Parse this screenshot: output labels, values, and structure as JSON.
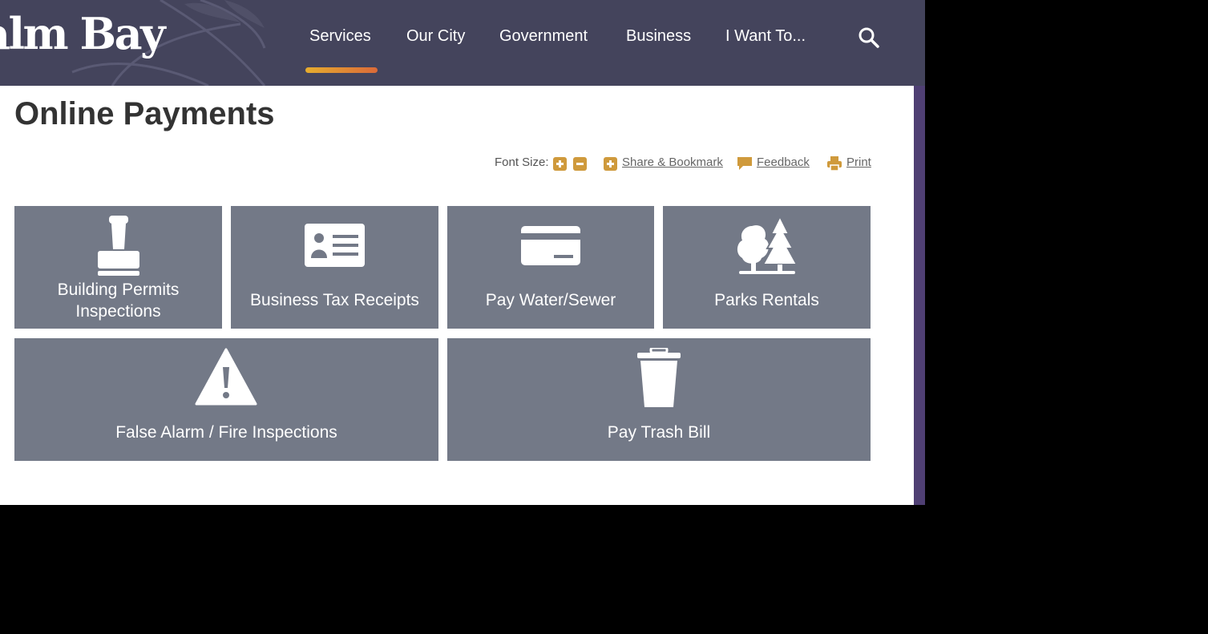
{
  "header": {
    "logo_text": "alm Bay",
    "nav": [
      {
        "label": "Services",
        "active": true
      },
      {
        "label": "Our City"
      },
      {
        "label": "Government"
      },
      {
        "label": "Business"
      },
      {
        "label": "I Want To..."
      }
    ],
    "search_icon": "search-icon"
  },
  "page": {
    "title": "Online Payments"
  },
  "toolbar": {
    "font_size_label": "Font Size:",
    "share_label": "Share & Bookmark",
    "feedback_label": "Feedback",
    "print_label": "Print"
  },
  "tiles": [
    {
      "label_line1": "Building Permits",
      "label_line2": "Inspections",
      "icon": "stamp-icon"
    },
    {
      "label": "Business Tax Receipts",
      "icon": "id-card-icon"
    },
    {
      "label": "Pay Water/Sewer",
      "icon": "credit-card-icon"
    },
    {
      "label": "Parks Rentals",
      "icon": "trees-icon"
    },
    {
      "label": "False Alarm / Fire Inspections",
      "icon": "warning-icon"
    },
    {
      "label": "Pay Trash Bill",
      "icon": "trash-can-icon"
    }
  ],
  "colors": {
    "header_bg": "#44445c",
    "accent": "#cf9a3c",
    "tile_bg": "#737987",
    "underline_start": "#e6ad2e",
    "underline_end": "#db6a39"
  }
}
